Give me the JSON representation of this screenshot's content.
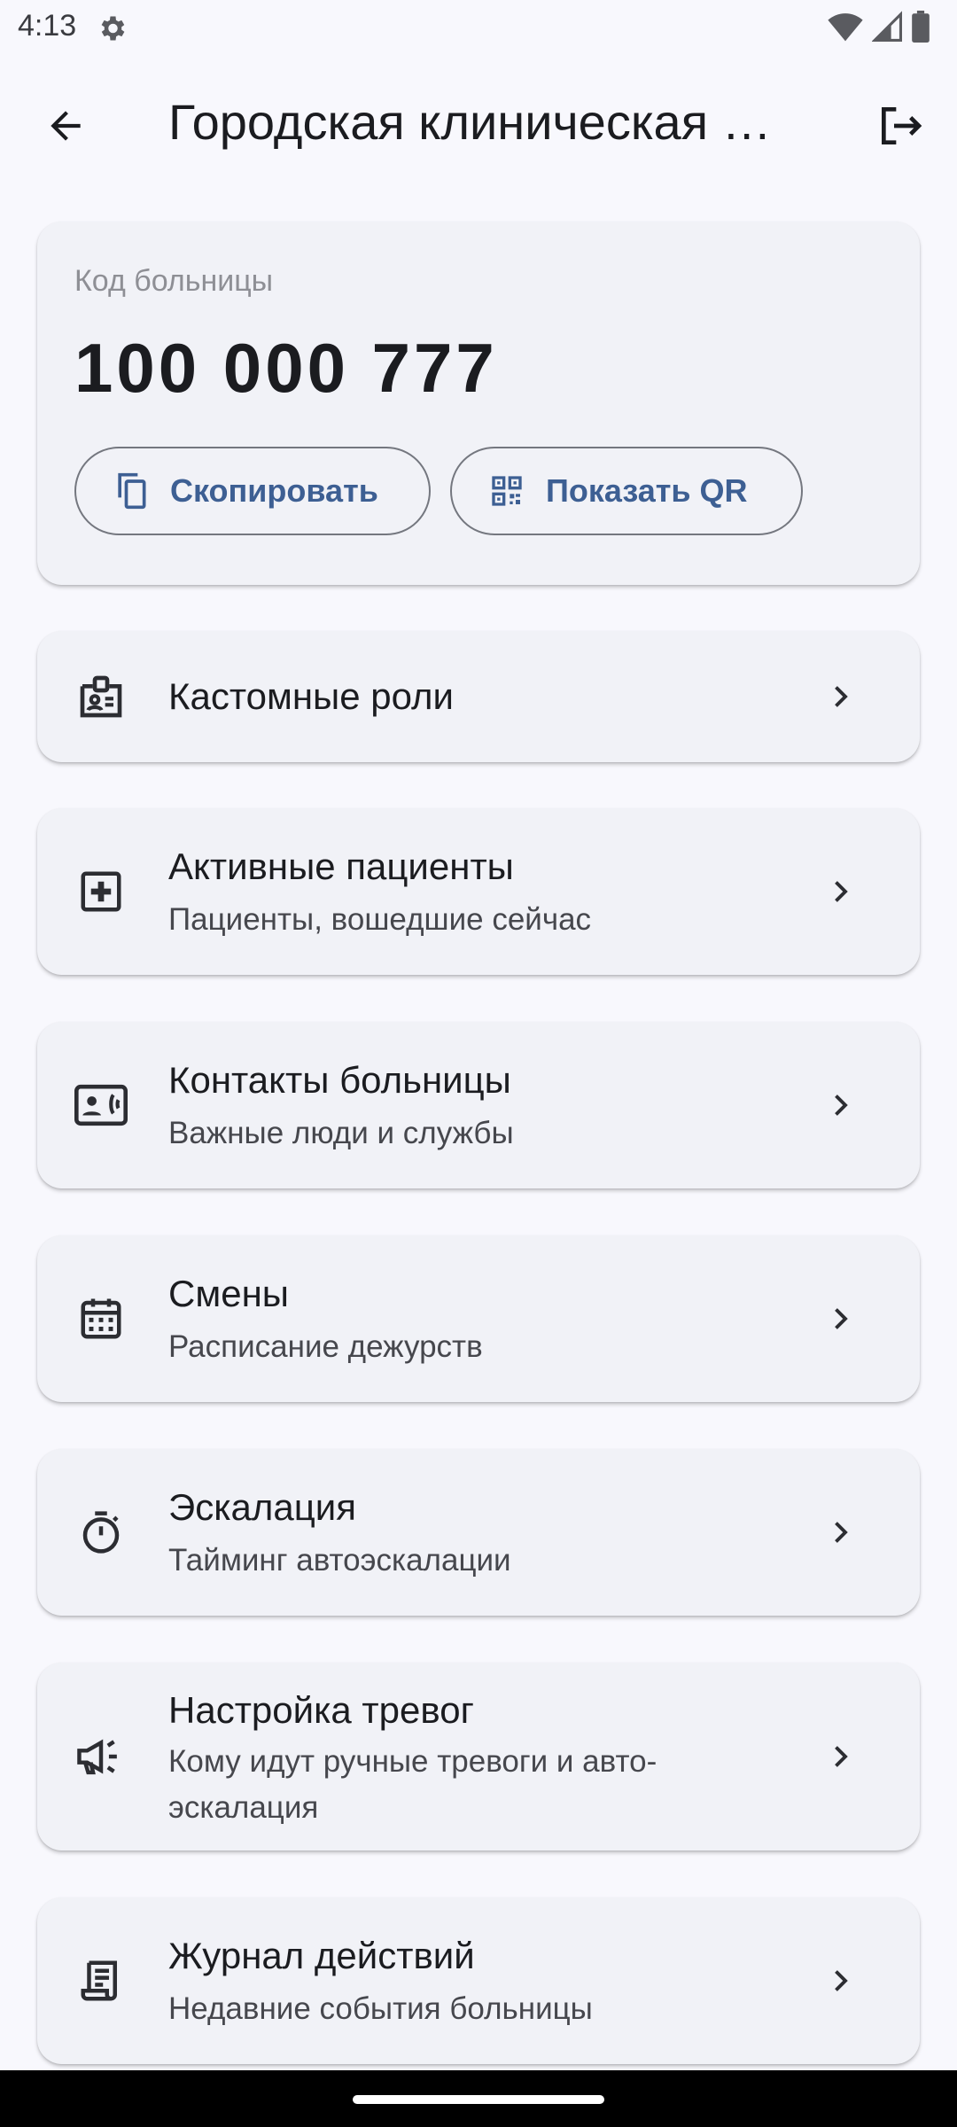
{
  "status": {
    "time": "4:13"
  },
  "app_bar": {
    "title": "Городская клиническая больница"
  },
  "hospital_code": {
    "label": "Код больницы",
    "value": "100 000 777",
    "copy_label": "Скопировать",
    "qr_label": "Показать QR"
  },
  "menu": [
    {
      "title": "Кастомные роли",
      "icon": "badge-icon"
    },
    {
      "title": "Активные пациенты",
      "subtitle": "Пациенты, вошедшие сейчас",
      "icon": "medical-plus-icon"
    },
    {
      "title": "Контакты больницы",
      "subtitle": "Важные люди и службы",
      "icon": "contact-phone-icon"
    },
    {
      "title": "Смены",
      "subtitle": "Расписание дежурств",
      "icon": "calendar-icon"
    },
    {
      "title": "Эскалация",
      "subtitle": "Тайминг автоэскалации",
      "icon": "timer-icon"
    },
    {
      "title": "Настройка тревог",
      "subtitle": "Кому идут ручные тревоги и авто-эскалация",
      "icon": "campaign-icon"
    },
    {
      "title": "Журнал действий",
      "subtitle": "Недавние события больницы",
      "icon": "receipt-log-icon"
    }
  ],
  "colors": {
    "accent": "#3d5f93",
    "card": "#f1f2f7",
    "background": "#f8f8fd"
  }
}
